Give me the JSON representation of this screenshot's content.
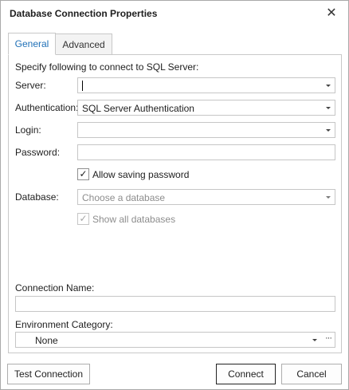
{
  "window": {
    "title": "Database Connection Properties"
  },
  "tabs": [
    {
      "label": "General"
    },
    {
      "label": "Advanced"
    }
  ],
  "general": {
    "intro": "Specify following to connect to SQL Server:",
    "server_label": "Server:",
    "server_value": "",
    "auth_label": "Authentication:",
    "auth_value": "SQL Server Authentication",
    "login_label": "Login:",
    "login_value": "",
    "password_label": "Password:",
    "allow_saving_label": "Allow saving password",
    "allow_saving_checked": true,
    "database_label": "Database:",
    "database_placeholder": "Choose a database",
    "show_all_label": "Show all databases",
    "show_all_checked": true,
    "connection_name_label": "Connection Name:",
    "connection_name_value": "",
    "env_category_label": "Environment Category:",
    "env_category_value": "None"
  },
  "buttons": {
    "test": "Test Connection",
    "connect": "Connect",
    "cancel": "Cancel"
  },
  "icons": {
    "close": "close-icon",
    "dropdown": "chevron-down-icon",
    "check": "checkmark-icon",
    "ellipsis": "ellipsis-icon"
  }
}
